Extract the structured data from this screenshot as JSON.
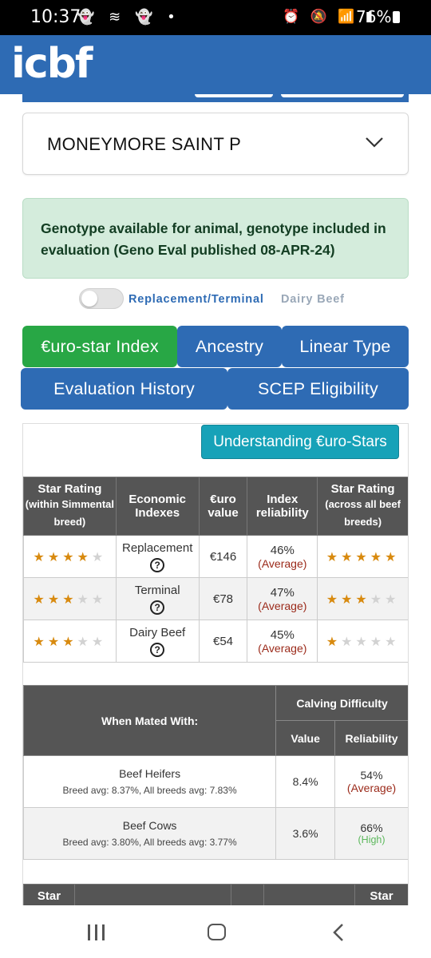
{
  "status_bar": {
    "time": "10:37",
    "left_icons": "👻 ≋ 👻 •",
    "right_icons": "⏰ 🔕 📶 ▮",
    "battery": "76%"
  },
  "app_bar": {
    "logo": "icbf"
  },
  "animal_select": {
    "value": "MONEYMORE SAINT P",
    "icon": "chevron-down-icon"
  },
  "alert": {
    "text": "Genotype available for animal, genotype included in evaluation (Geno Eval published 08-APR-24)"
  },
  "toggle": {
    "label_on": "Replacement/Terminal",
    "label_off": "Dairy Beef",
    "checked": false
  },
  "tabs": [
    {
      "label": "€uro-star Index",
      "active": true
    },
    {
      "label": "Ancestry",
      "active": false
    },
    {
      "label": "Linear Type",
      "active": false
    },
    {
      "label": "Evaluation History",
      "active": false
    },
    {
      "label": "SCEP Eligibility",
      "active": false
    }
  ],
  "understand_button": "Understanding €uro-Stars",
  "eurostar_table": {
    "headers": {
      "star_within": "Star Rating",
      "star_within_sub": "(within Simmental breed)",
      "economic": "Economic Indexes",
      "euro_value": "€uro value",
      "reliability": "Index reliability",
      "star_across": "Star Rating",
      "star_across_sub": "(across all beef breeds)"
    },
    "rows": [
      {
        "index": "Replacement",
        "value": "€146",
        "reliability": "46%",
        "reliability_label": "(Average)",
        "stars_within": 4,
        "stars_across": 5
      },
      {
        "index": "Terminal",
        "value": "€78",
        "reliability": "47%",
        "reliability_label": "(Average)",
        "stars_within": 3,
        "stars_across": 3
      },
      {
        "index": "Dairy Beef",
        "value": "€54",
        "reliability": "45%",
        "reliability_label": "(Average)",
        "stars_within": 3,
        "stars_across": 1
      }
    ],
    "help_icon": "?"
  },
  "calving_table": {
    "headers": {
      "mated_with": "When Mated With:",
      "group": "Calving Difficulty",
      "value": "Value",
      "reliability": "Reliability"
    },
    "rows": [
      {
        "label": "Beef Heifers",
        "sub": "Breed avg: 8.37%, All breeds avg: 7.83%",
        "value": "8.4%",
        "reliability": "54%",
        "reliability_label": "(Average)"
      },
      {
        "label": "Beef Cows",
        "sub": "Breed avg: 3.80%, All breeds avg: 3.77%",
        "value": "3.6%",
        "reliability": "66%",
        "reliability_label": "(High)"
      }
    ]
  },
  "next_table": {
    "header_left": "Star",
    "header_right": "Star"
  },
  "colors": {
    "primary": "#2e6bb4",
    "active_tab": "#28a745",
    "info": "#17a2b8",
    "star": "#d88a0f",
    "table_header": "#555555"
  }
}
